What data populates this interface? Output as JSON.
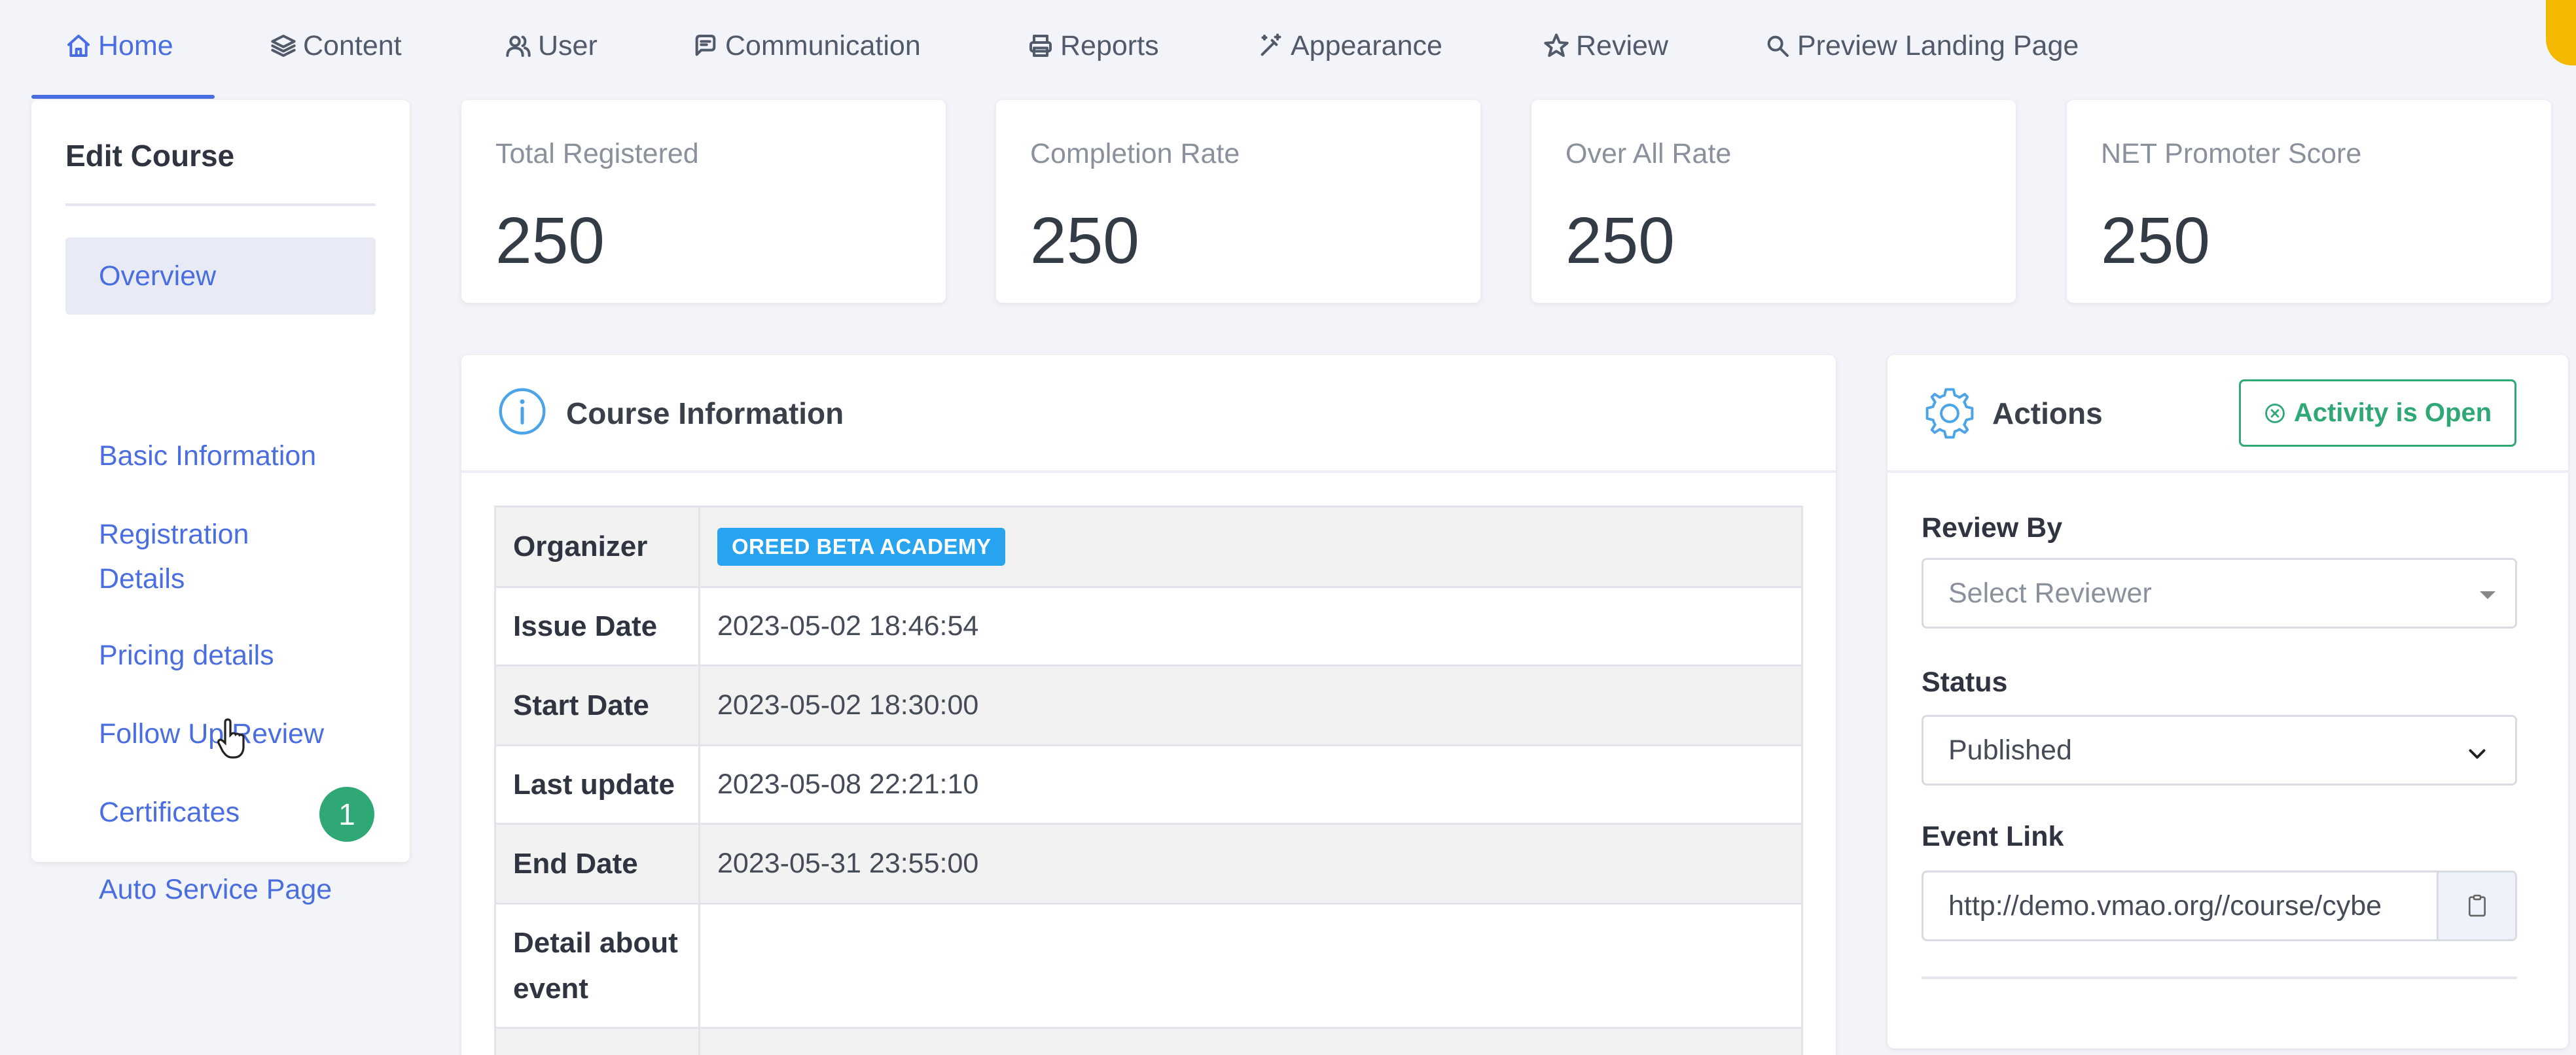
{
  "nav": {
    "items": [
      {
        "label": "Home",
        "icon": "home-icon",
        "active": true
      },
      {
        "label": "Content",
        "icon": "layers-icon"
      },
      {
        "label": "User",
        "icon": "users-icon"
      },
      {
        "label": "Communication",
        "icon": "chat-icon"
      },
      {
        "label": "Reports",
        "icon": "printer-icon"
      },
      {
        "label": "Appearance",
        "icon": "magic-wand-icon"
      },
      {
        "label": "Review",
        "icon": "star-icon"
      },
      {
        "label": "Preview Landing Page",
        "icon": "search-icon"
      }
    ],
    "accent": "#4a6ee0"
  },
  "sidebar": {
    "title": "Edit Course",
    "items": [
      {
        "label": "Overview",
        "active": true
      },
      {
        "label": "Basic Information"
      },
      {
        "label": "Registration Details"
      },
      {
        "label": "Pricing details"
      },
      {
        "label": "Follow Up Review"
      },
      {
        "label": "Certificates"
      },
      {
        "label": "Auto Service Page"
      }
    ],
    "step_badge": "1"
  },
  "stats": [
    {
      "label": "Total Registered",
      "value": "250"
    },
    {
      "label": "Completion Rate",
      "value": "250"
    },
    {
      "label": "Over All Rate",
      "value": "250"
    },
    {
      "label": "NET Promoter Score",
      "value": "250"
    }
  ],
  "course_info": {
    "title": "Course Information",
    "rows": [
      {
        "key": "Organizer",
        "value": "OREED BETA ACADEMY",
        "badge": true
      },
      {
        "key": "Issue Date",
        "value": "2023-05-02 18:46:54"
      },
      {
        "key": "Start Date",
        "value": "2023-05-02 18:30:00"
      },
      {
        "key": "Last update",
        "value": "2023-05-08 22:21:10"
      },
      {
        "key": "End Date",
        "value": "2023-05-31 23:55:00"
      },
      {
        "key": "Detail about event",
        "value": ""
      }
    ]
  },
  "actions": {
    "title": "Actions",
    "status_button": "Activity is Open",
    "review_by_label": "Review By",
    "review_by_placeholder": "Select Reviewer",
    "status_label": "Status",
    "status_value": "Published",
    "event_link_label": "Event Link",
    "event_link_value": "http://demo.vmao.org//course/cybe",
    "success_color": "#2fa876"
  }
}
